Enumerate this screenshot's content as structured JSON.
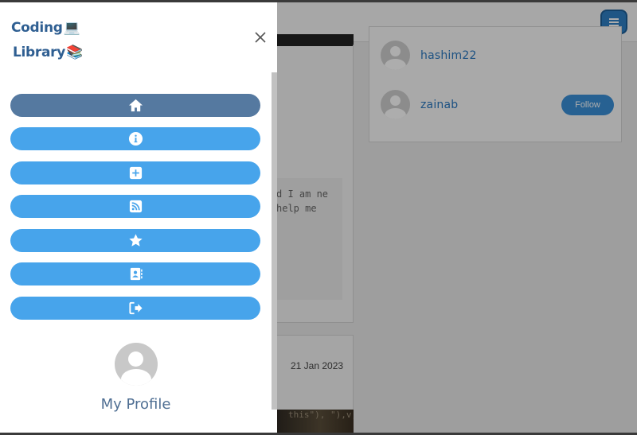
{
  "brand": {
    "line1": "Coding",
    "line1_emoji": "💻",
    "line2": "Library",
    "line2_emoji": "📚"
  },
  "menu": {
    "items": [
      {
        "icon": "home-icon",
        "active": true
      },
      {
        "icon": "info-icon",
        "active": false
      },
      {
        "icon": "plus-square-icon",
        "active": false
      },
      {
        "icon": "rss-icon",
        "active": false
      },
      {
        "icon": "star-icon",
        "active": false
      },
      {
        "icon": "contacts-icon",
        "active": false
      },
      {
        "icon": "logout-icon",
        "active": false
      }
    ]
  },
  "profile": {
    "label": "My Profile"
  },
  "suggestions": {
    "users": [
      {
        "name": "hashim22"
      },
      {
        "name": "zainab",
        "follow_label": "Follow"
      }
    ]
  },
  "post": {
    "text_fragment": "d I am ne help me",
    "date": "21 Jan 2023",
    "image_code": "this\"),\n\"),v,xo"
  },
  "colors": {
    "menu_button": "#47a4eb",
    "menu_button_active": "#5579a0",
    "brand": "#2f5f92",
    "accent": "#2f7fc4"
  }
}
